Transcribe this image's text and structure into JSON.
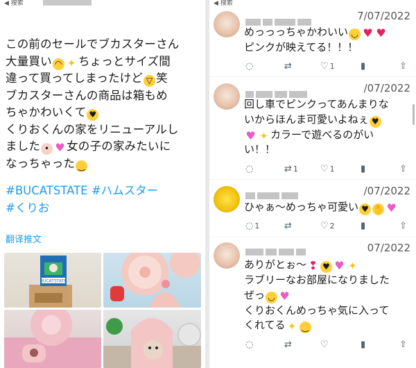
{
  "left": {
    "back_label": "搜索",
    "tweet_lines": [
      "この前のセールでブカスターさん",
      "大量買い",
      "ちょっとサイズ間",
      "違って買ってしまったけど",
      "笑",
      "ブカスターさんの商品は箱もめ",
      "ちゃかわいくて",
      "くりおくんの家をリニューアルし",
      "ました",
      "女の子の家みたいに",
      "なっちゃった"
    ],
    "hashtags_line1": "#BUCATSTATE #ハムスター",
    "hashtags_line2": "#くりお",
    "translate": "翻译推文",
    "box_label": "BUCATSTATE"
  },
  "right": {
    "back_label": "搜索",
    "replies": [
      {
        "date": "7/07/2022",
        "lines": [
          "めっっっちゃかわいい",
          "ピンクが映えてる！！！"
        ],
        "counts": {
          "reply": "",
          "retweet": "",
          "like": "1",
          "views": ""
        }
      },
      {
        "date": "/07/2022",
        "lines": [
          "回し車でピンクってあんまりな",
          "いからほんま可愛いよねぇ",
          "カラーで遊べるのがい",
          "い！！"
        ],
        "counts": {
          "reply": "",
          "retweet": "1",
          "like": "1",
          "views": ""
        }
      },
      {
        "date": "/07/2022",
        "lines": [
          "ひゃぁ～めっちゃ可愛い"
        ],
        "counts": {
          "reply": "1",
          "retweet": "",
          "like": "2",
          "views": ""
        }
      },
      {
        "date": "07/2022",
        "lines": [
          "ありがとぉ～",
          "ラブリーなお部屋になりました",
          "ぜっ",
          "くりおくんめっちゃ気に入って",
          "くれてる"
        ],
        "counts": {
          "reply": "",
          "retweet": "",
          "like": "",
          "views": ""
        }
      }
    ]
  },
  "icons": [
    "back-arrow-icon",
    "reply-icon",
    "retweet-icon",
    "like-icon",
    "views-icon",
    "share-icon"
  ]
}
